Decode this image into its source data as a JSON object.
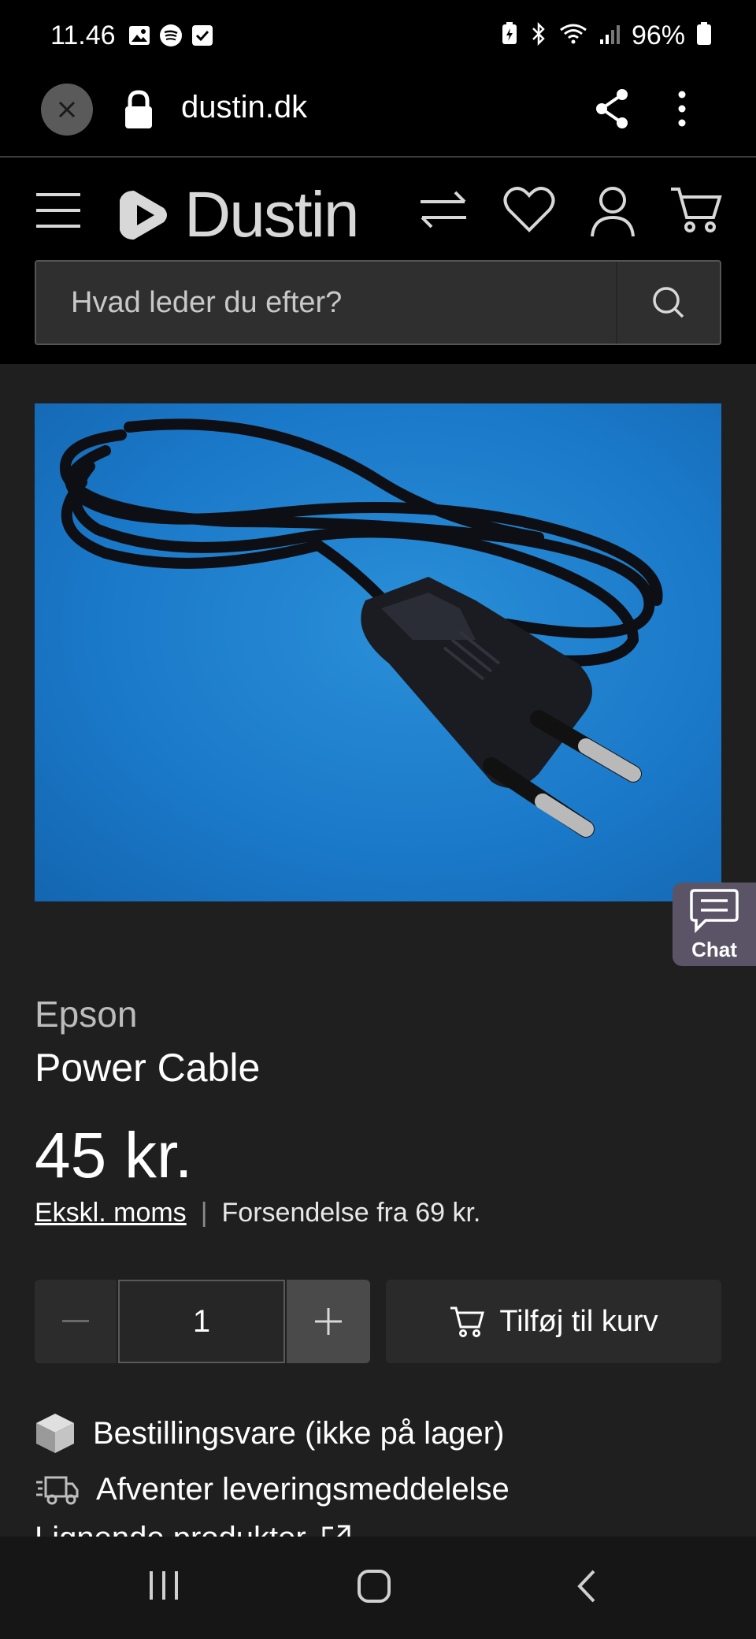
{
  "status_bar": {
    "time": "11.46",
    "battery": "96%"
  },
  "browser": {
    "url": "dustin.dk"
  },
  "site": {
    "logo_text": "Dustin",
    "search_placeholder": "Hvad leder du efter?"
  },
  "product": {
    "brand": "Epson",
    "name": "Power Cable",
    "price": "45 kr.",
    "vat_label": "Ekskl. moms",
    "separator": "|",
    "shipping": "Forsendelse fra 69 kr.",
    "quantity": "1",
    "add_to_cart": "Tilføj til kurv",
    "stock_status": "Bestillingsvare (ikke på lager)",
    "delivery_status": "Afventer leveringsmeddelelse",
    "related_products": "Lignende produkter"
  },
  "chat": {
    "label": "Chat"
  },
  "colors": {
    "background": "#1f1f1f",
    "header": "#000000",
    "image_bg": "#1a78c8",
    "chat_bg": "#5b5467"
  }
}
